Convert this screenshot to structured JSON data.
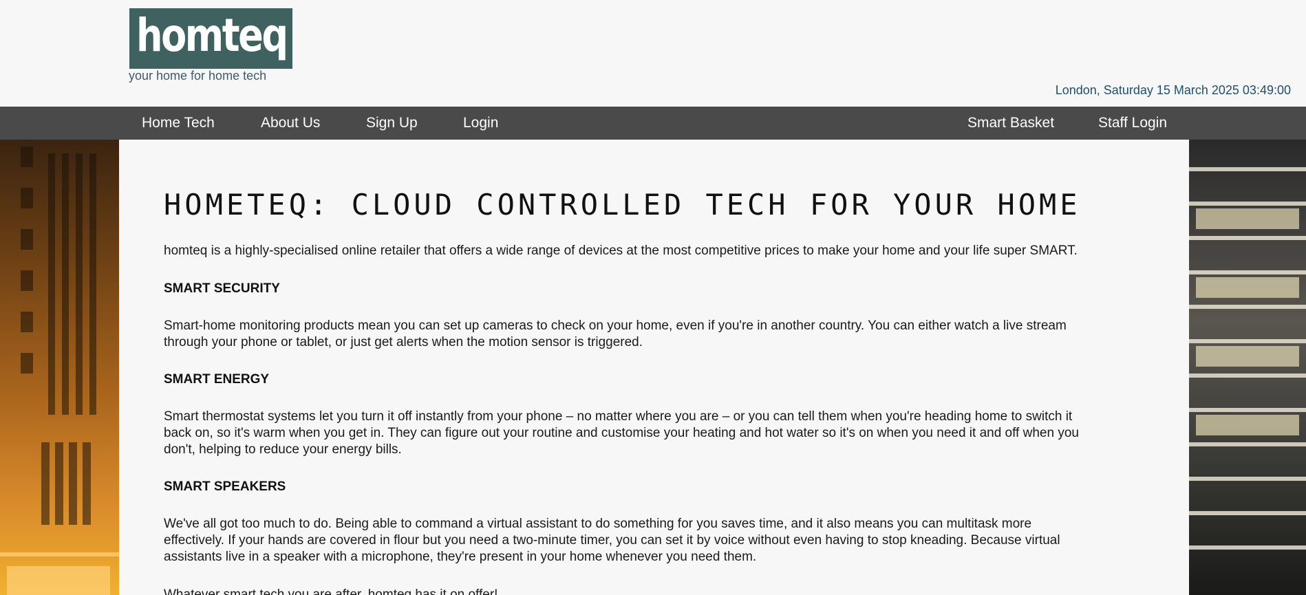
{
  "header": {
    "logo_text": "homteq",
    "tagline": "your home for home tech",
    "datetime": "London, Saturday 15 March 2025 03:49:00"
  },
  "nav": {
    "left": [
      {
        "label": "Home Tech"
      },
      {
        "label": "About Us"
      },
      {
        "label": "Sign Up"
      },
      {
        "label": "Login"
      }
    ],
    "right": [
      {
        "label": "Smart Basket"
      },
      {
        "label": "Staff Login"
      }
    ]
  },
  "main": {
    "title": "HOMETEQ: CLOUD CONTROLLED TECH FOR YOUR HOME",
    "intro": "homteq is a highly-specialised online retailer that offers a wide range of devices at the most competitive prices to make your home and your life super SMART.",
    "sections": [
      {
        "heading": "SMART SECURITY",
        "lines": [
          "Smart-home monitoring products mean you can set up cameras to check on your home, even if you're in another country. You can either watch a live stream",
          "through your phone or tablet, or just get alerts when the motion sensor is triggered."
        ]
      },
      {
        "heading": "SMART ENERGY",
        "lines": [
          "Smart thermostat systems let you turn it off instantly from your phone – no matter where you are – or you can tell them when you're heading home to switch it",
          "back on, so it's warm when you get in. They can figure out your routine and customise your heating and hot water so it's on when you need it and off when you",
          "don't, helping to reduce your energy bills."
        ]
      },
      {
        "heading": "SMART SPEAKERS",
        "lines": [
          "We've all got too much to do. Being able to command a virtual assistant to do something for you saves time, and it also means you can multitask more",
          "effectively. If your hands are covered in flour but you need a two-minute timer, you can set it by voice without even having to stop kneading. Because virtual",
          "assistants live in a speaker with a microphone, they're present in your home whenever you need them."
        ]
      }
    ],
    "closing": "Whatever smart tech you are after, homteq has it on offer!"
  }
}
